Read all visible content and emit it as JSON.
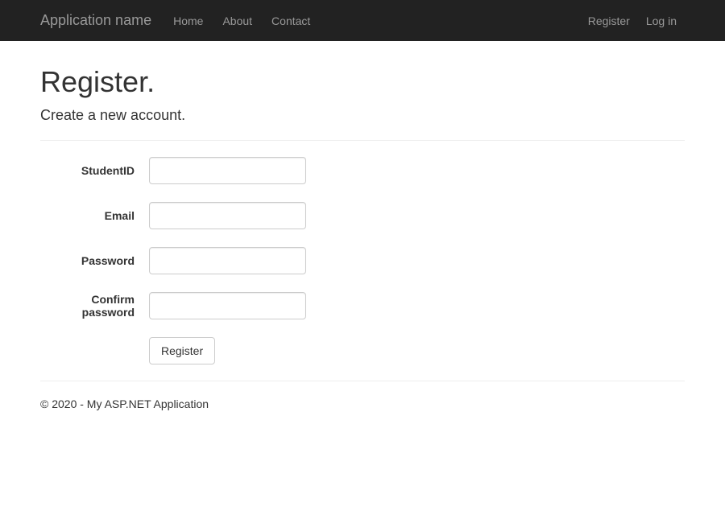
{
  "navbar": {
    "brand": "Application name",
    "left": [
      {
        "label": "Home"
      },
      {
        "label": "About"
      },
      {
        "label": "Contact"
      }
    ],
    "right": [
      {
        "label": "Register"
      },
      {
        "label": "Log in"
      }
    ]
  },
  "page": {
    "title": "Register.",
    "subtitle": "Create a new account."
  },
  "form": {
    "fields": {
      "studentid": {
        "label": "StudentID",
        "value": ""
      },
      "email": {
        "label": "Email",
        "value": ""
      },
      "password": {
        "label": "Password",
        "value": ""
      },
      "confirm": {
        "label": "Confirm password",
        "value": ""
      }
    },
    "submit_label": "Register"
  },
  "footer": {
    "text": "© 2020 - My ASP.NET Application"
  }
}
